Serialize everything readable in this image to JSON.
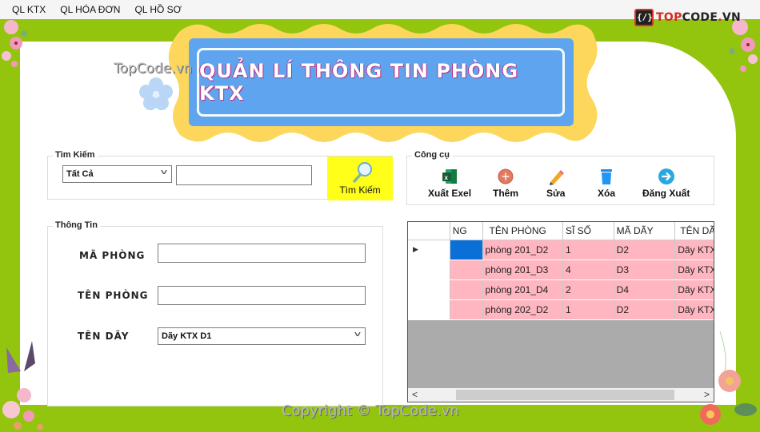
{
  "menu": {
    "items": [
      "QL KTX",
      "QL HÓA ĐƠN",
      "QL HỒ SƠ"
    ]
  },
  "brand": {
    "top": "TOP",
    "code": "CODE",
    "dot": ".",
    "vn": "VN",
    "icon": "topcode-logo-icon"
  },
  "banner": {
    "title": "QUẢN LÍ THÔNG TIN PHÒNG KTX"
  },
  "watermarks": {
    "top": "TopCode.vn",
    "bottom": "Copyright © TopCode.vn"
  },
  "search": {
    "legend": "Tìm Kiếm",
    "filter_selected": "Tất Cả",
    "query_value": "",
    "button_label": "Tìm Kiếm",
    "button_icon": "magnifier-icon",
    "button_color": "#ffff1a"
  },
  "tools": {
    "legend": "Công cụ",
    "buttons": [
      {
        "label": "Xuất Exel",
        "icon": "excel-icon"
      },
      {
        "label": "Thêm",
        "icon": "add-icon"
      },
      {
        "label": "Sửa",
        "icon": "pencil-icon"
      },
      {
        "label": "Xóa",
        "icon": "trash-icon"
      },
      {
        "label": "Đăng Xuất",
        "icon": "logout-icon"
      }
    ]
  },
  "info": {
    "legend": "Thông Tin",
    "fields": {
      "ma_phong": {
        "label": "MÃ PHÒNG",
        "value": ""
      },
      "ten_phong": {
        "label": "TÊN PHÒNG",
        "value": ""
      },
      "ten_day": {
        "label": "TÊN DÃY",
        "selected": "Dãy KTX D1"
      }
    }
  },
  "grid": {
    "columns": [
      "NG",
      "TÊN PHÒNG",
      "SĨ SỐ",
      "MÃ DÃY",
      "TÊN DÃ"
    ],
    "rows": [
      {
        "ma": "",
        "ten_phong": "phòng 201_D2",
        "si_so": "1",
        "ma_day": "D2",
        "ten_day": "Dãy KTX",
        "current": true
      },
      {
        "ma": "",
        "ten_phong": "phòng 201_D3",
        "si_so": "4",
        "ma_day": "D3",
        "ten_day": "Dãy KTX",
        "current": false
      },
      {
        "ma": "",
        "ten_phong": "phòng 201_D4",
        "si_so": "2",
        "ma_day": "D4",
        "ten_day": "Dãy KTX",
        "current": false
      },
      {
        "ma": "",
        "ten_phong": "phòng 202_D2",
        "si_so": "1",
        "ma_day": "D2",
        "ten_day": "Dãy KTX",
        "current": false
      }
    ],
    "current_row_marker": "▶",
    "row_color": "#ffb6c1",
    "selected_cell_color": "#0a6fd6",
    "scroll_left": "<",
    "scroll_right": ">"
  },
  "colors": {
    "frame_green": "#93c50e",
    "banner_blue": "#5ea4ef",
    "banner_wave_yellow": "#fdd75c"
  }
}
